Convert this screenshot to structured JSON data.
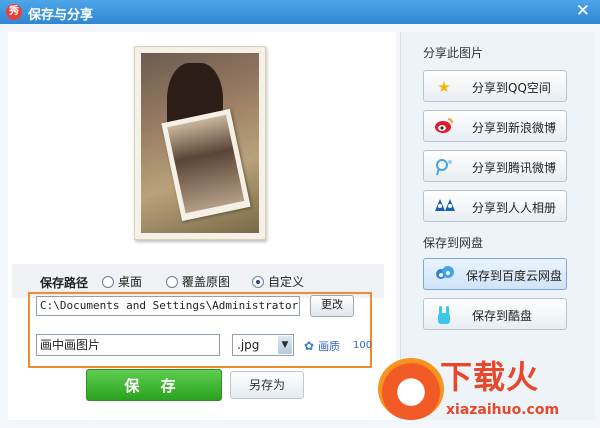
{
  "window": {
    "logo_char": "秀",
    "title": "保存与分享"
  },
  "save": {
    "path_label": "保存路径",
    "locations": [
      {
        "label": "桌面",
        "selected": false
      },
      {
        "label": "覆盖原图",
        "selected": false
      },
      {
        "label": "自定义",
        "selected": true
      }
    ],
    "path_value": "C:\\Documents and Settings\\Administrator\\桌",
    "change_button": "更改",
    "filename_value": "画中画图片",
    "format_selected": ".jpg",
    "quality_label": "画质",
    "quality_value": "100",
    "save_button": "保 存",
    "save_as_button": "另存为"
  },
  "share": {
    "section_title": "分享此图片",
    "items": [
      {
        "label": "分享到QQ空间",
        "icon": "star-icon"
      },
      {
        "label": "分享到新浪微博",
        "icon": "weibo-icon"
      },
      {
        "label": "分享到腾讯微博",
        "icon": "tencent-weibo-icon"
      },
      {
        "label": "分享到人人相册",
        "icon": "renren-icon"
      }
    ]
  },
  "cloud": {
    "section_title": "保存到网盘",
    "items": [
      {
        "label": "保存到百度云网盘",
        "icon": "baidu-cloud-icon"
      },
      {
        "label": "保存到酷盘",
        "icon": "kupan-icon"
      }
    ]
  },
  "watermark": {
    "text": "下载火",
    "url": "xiazaihuo.com"
  },
  "colors": {
    "titlebar": "#3a93dc",
    "save_green": "#3bb52c",
    "highlight_orange": "#f28a2e",
    "link_blue": "#3366cc"
  }
}
